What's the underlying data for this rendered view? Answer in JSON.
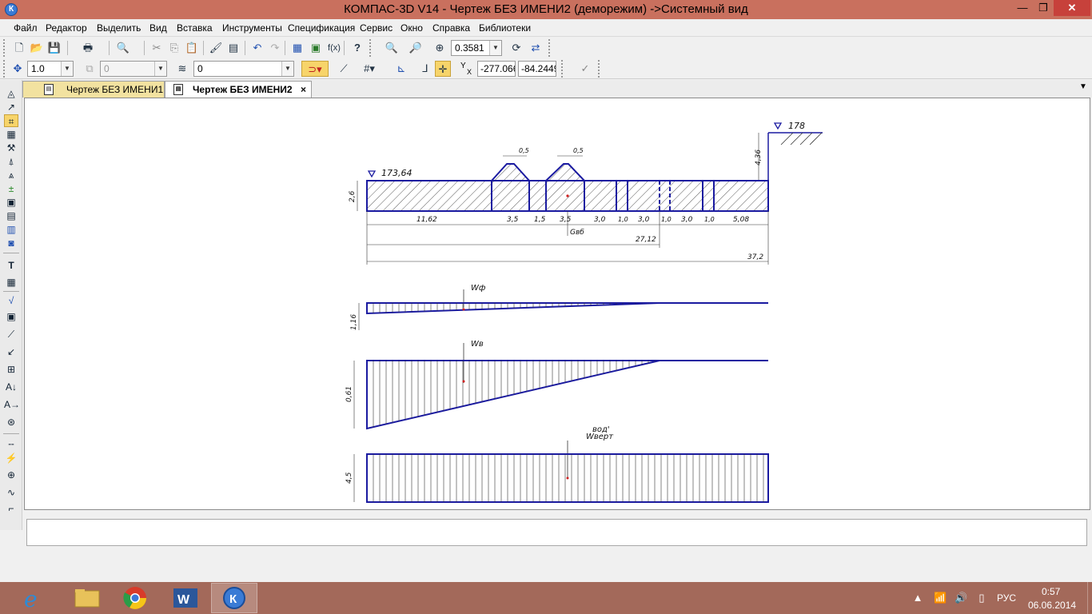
{
  "window": {
    "title": "КОМПАС-3D V14 - Чертеж БЕЗ ИМЕНИ2 (деморежим) ->Системный вид",
    "min_label": "—",
    "max_label": "❐",
    "close_label": "✕"
  },
  "menu": {
    "items": [
      "Файл",
      "Редактор",
      "Выделить",
      "Вид",
      "Вставка",
      "Инструменты",
      "Спецификация",
      "Сервис",
      "Окно",
      "Справка",
      "Библиотеки"
    ]
  },
  "toolbar1": {
    "zoom_value": "0.3581"
  },
  "toolbar2": {
    "step_value": "1.0",
    "layer_combo_value": "0",
    "style_combo_value": "0",
    "x_label": "X",
    "y_label": "Y",
    "coord_x": "-277.066",
    "coord_y": "-84.2449"
  },
  "tabs": [
    {
      "label": "Чертеж БЕЗ ИМЕНИ1",
      "active": false
    },
    {
      "label": "Чертеж БЕЗ ИМЕНИ2",
      "active": true
    }
  ],
  "tab_close_label": "×",
  "drawing": {
    "section_labels": {
      "level_left": "173,64",
      "level_right": "178",
      "height_left": "2,6",
      "height_right": "4,36",
      "top_dim_1": "0,5",
      "top_dim_2": "0,5",
      "segments": [
        "11,62",
        "3,5",
        "1,5",
        "3,5",
        "3,0",
        "1,0",
        "3,0",
        "1,0",
        "3,0",
        "1,0",
        "5,08"
      ],
      "center_label": "Gвб",
      "dim_mid": "27,12",
      "dim_total": "37,2"
    },
    "diagram_wf": {
      "label": "Wф",
      "value": "1,16"
    },
    "diagram_wv": {
      "label": "Wв",
      "value": "0,61"
    },
    "diagram_wvert": {
      "label_top": "вод'",
      "label": "Wверт",
      "value": "4,5"
    }
  },
  "taskbar": {
    "apps": [
      "internet-explorer",
      "file-explorer",
      "chrome",
      "word",
      "kompas"
    ],
    "language": "РУС",
    "time": "0:57",
    "date": "06.06.2014"
  }
}
